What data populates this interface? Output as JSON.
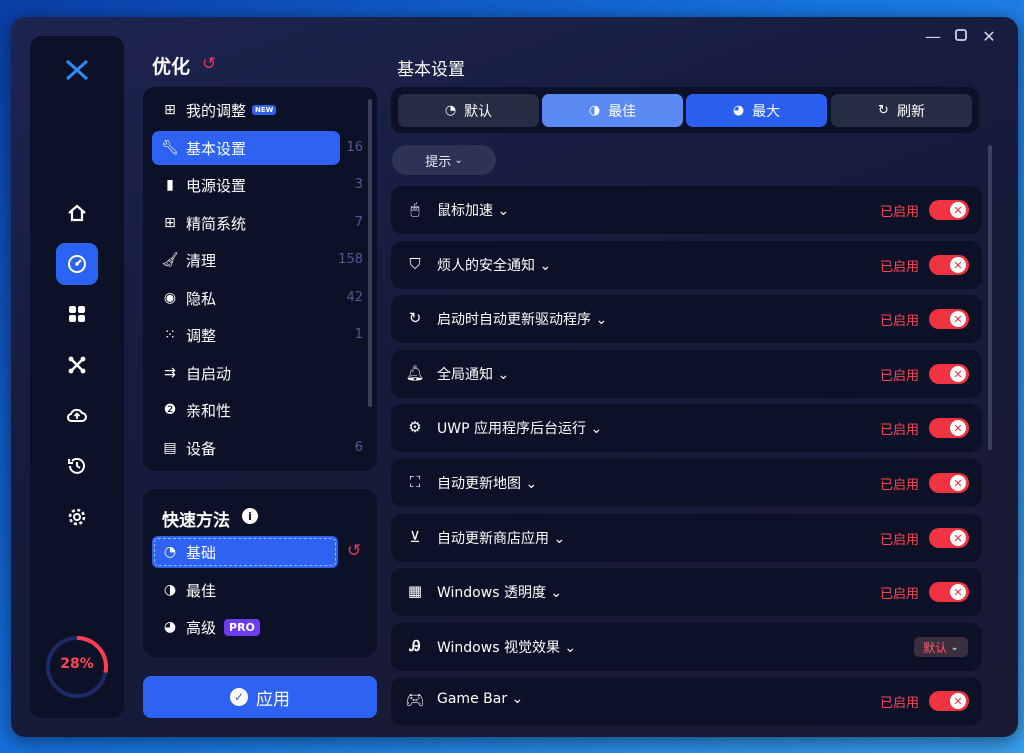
{
  "colors": {
    "accent": "#2d62f3",
    "enabled": "#ef3340",
    "panel": "#0c1127"
  },
  "gauge": {
    "value": "28%",
    "fraction": 0.28
  },
  "rail_icons": [
    "home-icon",
    "gauge-icon",
    "apps-icon",
    "tools-icon",
    "cloud-upload-icon",
    "history-icon",
    "settings-icon"
  ],
  "optimize": {
    "title": "优化",
    "categories": [
      {
        "label": "我的调整",
        "icon": "tune-icon",
        "badge": "NEW",
        "count": ""
      },
      {
        "label": "基本设置",
        "icon": "wrench-icon",
        "count": "16"
      },
      {
        "label": "电源设置",
        "icon": "battery-icon",
        "count": "3"
      },
      {
        "label": "精简系统",
        "icon": "windows-icon",
        "count": "7"
      },
      {
        "label": "清理",
        "icon": "broom-icon",
        "count": "158"
      },
      {
        "label": "隐私",
        "icon": "privacy-icon",
        "count": "42"
      },
      {
        "label": "调整",
        "icon": "grid-icon",
        "count": "1"
      },
      {
        "label": "自启动",
        "icon": "startup-icon",
        "count": ""
      },
      {
        "label": "亲和性",
        "icon": "affinity-icon",
        "count": ""
      },
      {
        "label": "设备",
        "icon": "device-icon",
        "count": "6"
      }
    ]
  },
  "quick": {
    "title": "快速方法",
    "items": [
      {
        "label": "基础",
        "icon": "speedometer-low-icon"
      },
      {
        "label": "最佳",
        "icon": "speedometer-mid-icon"
      },
      {
        "label": "高级",
        "icon": "speedometer-high-icon",
        "badge": "PRO"
      }
    ]
  },
  "apply_label": "应用",
  "main": {
    "title": "基本设置",
    "presets": [
      {
        "label": "默认",
        "icon": "speedometer-low-icon"
      },
      {
        "label": "最佳",
        "icon": "speedometer-mid-icon"
      },
      {
        "label": "最大",
        "icon": "speedometer-high-icon"
      },
      {
        "label": "刷新",
        "icon": "refresh-icon"
      }
    ],
    "hint": "提示",
    "settings": [
      {
        "label": "鼠标加速",
        "icon": "mouse-icon",
        "status": "已启用",
        "control": "toggle"
      },
      {
        "label": "烦人的安全通知",
        "icon": "shield-icon",
        "status": "已启用",
        "control": "toggle"
      },
      {
        "label": "启动时自动更新驱动程序",
        "icon": "update-icon",
        "status": "已启用",
        "control": "toggle"
      },
      {
        "label": "全局通知",
        "icon": "bell-icon",
        "status": "已启用",
        "control": "toggle"
      },
      {
        "label": "UWP 应用程序后台运行",
        "icon": "gear-apps-icon",
        "status": "已启用",
        "control": "toggle"
      },
      {
        "label": "自动更新地图",
        "icon": "map-icon",
        "status": "已启用",
        "control": "toggle"
      },
      {
        "label": "自动更新商店应用",
        "icon": "download-icon",
        "status": "已启用",
        "control": "toggle"
      },
      {
        "label": "Windows 透明度",
        "icon": "transparency-icon",
        "status": "已启用",
        "control": "toggle"
      },
      {
        "label": "Windows 视觉效果",
        "icon": "visual-effects-icon",
        "status": "默认",
        "control": "select"
      },
      {
        "label": "Game Bar",
        "icon": "gamepad-icon",
        "status": "已启用",
        "control": "toggle"
      }
    ]
  }
}
